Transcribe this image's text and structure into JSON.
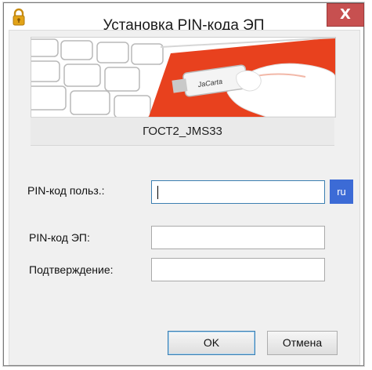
{
  "window": {
    "title": "Установка PIN-кода ЭП",
    "close_label": "X"
  },
  "banner": {
    "card_brand": "JaCarta"
  },
  "token": {
    "name": "ГОСТ2_JMS33"
  },
  "form": {
    "user_pin_label": "PIN-код польз.:",
    "user_pin_value": "",
    "language_indicator": "ru",
    "ep_pin_label": "PIN-код ЭП:",
    "ep_pin_value": "",
    "confirm_label": "Подтверждение:",
    "confirm_value": ""
  },
  "buttons": {
    "ok_label": "OK",
    "cancel_label": "Отмена"
  },
  "colors": {
    "close_button": "#c75050",
    "banner_red": "#e8411e",
    "language_badge": "#3c6bd6",
    "lock_icon": "#e2a317"
  }
}
